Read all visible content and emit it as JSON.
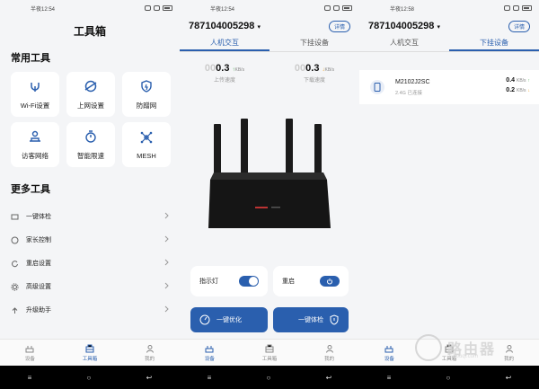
{
  "status": {
    "p1_time": "半夜12:54",
    "p2_time": "半夜12:54",
    "p3_time": "半夜12:58"
  },
  "toolbox": {
    "title": "工具箱",
    "common_title": "常用工具",
    "tiles": [
      {
        "label": "Wi-Fi设置",
        "icon": "wifi-settings-icon"
      },
      {
        "label": "上网设置",
        "icon": "globe-icon"
      },
      {
        "label": "防蹭网",
        "icon": "shield-icon"
      },
      {
        "label": "访客网络",
        "icon": "guest-icon"
      },
      {
        "label": "智能限速",
        "icon": "speed-limit-icon"
      },
      {
        "label": "MESH",
        "icon": "mesh-icon"
      }
    ],
    "more_title": "更多工具",
    "list": [
      {
        "label": "一键体检",
        "icon": "checkup-icon"
      },
      {
        "label": "家长控制",
        "icon": "parental-icon"
      },
      {
        "label": "重启设置",
        "icon": "restart-icon"
      },
      {
        "label": "高级设置",
        "icon": "gear-icon"
      },
      {
        "label": "升级助手",
        "icon": "upgrade-icon"
      }
    ]
  },
  "tabbar": {
    "devices": "设备",
    "toolbox": "工具箱",
    "mine": "我的"
  },
  "device": {
    "serial": "787104005298",
    "detail_label": "详情",
    "tab_interaction": "人机交互",
    "tab_connected": "下挂设备",
    "upload_value": "0.3",
    "upload_prefix": "00",
    "upload_unit": "KB/s",
    "upload_label": "上传速度",
    "download_value": "0.3",
    "download_prefix": "00",
    "download_unit": "KB/s",
    "download_label": "下载速度",
    "indicator_label": "指示灯",
    "restart_label": "重启",
    "optimize_label": "一键优化",
    "checkup_label": "一键体检"
  },
  "connected": {
    "name": "M2102J2SC",
    "sub": "2.4G 已连接",
    "up_rate": "0.4",
    "down_rate": "0.2",
    "unit": "KB/s"
  },
  "watermark": {
    "main": "路由器",
    "sub": "luyouqi.com"
  },
  "colors": {
    "accent": "#2a5fae",
    "bg": "#f4f5f7"
  }
}
